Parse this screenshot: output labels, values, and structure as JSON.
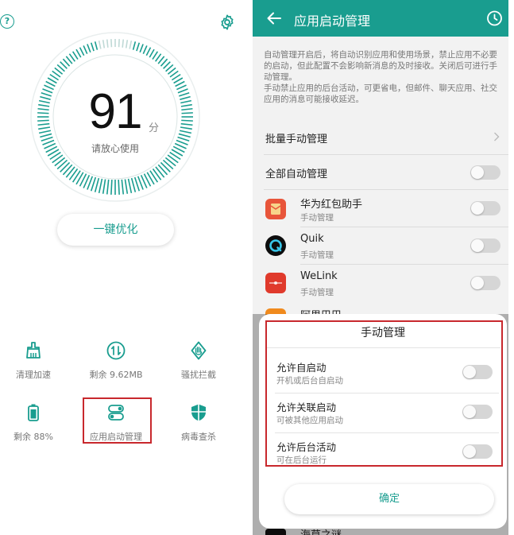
{
  "left": {
    "score": "91",
    "score_unit": "分",
    "score_subtitle": "请放心使用",
    "optimize_label": "一键优化",
    "tools": [
      {
        "label": "清理加速",
        "icon": "cleaner-icon"
      },
      {
        "label": "剩余 9.62MB",
        "icon": "data-usage-icon"
      },
      {
        "label": "骚扰拦截",
        "icon": "block-harassment-icon"
      },
      {
        "label": "剩余 88%",
        "icon": "battery-icon"
      },
      {
        "label": "应用启动管理",
        "icon": "app-launch-icon"
      },
      {
        "label": "病毒查杀",
        "icon": "virus-scan-icon"
      }
    ],
    "colors": {
      "accent": "#199d8f",
      "highlight": "#c8282d"
    }
  },
  "right": {
    "appbar_title": "应用启动管理",
    "description_1": "自动管理开启后，将自动识别应用和使用场景，禁止应用不必要的启动，但此配置不会影响新消息的及时接收。关闭后可进行手动管理。",
    "description_2": "手动禁止应用的后台活动，可更省电，但邮件、聊天应用、社交应用的消息可能接收延迟。",
    "batch_manual": "批量手动管理",
    "all_auto": "全部自动管理",
    "apps": [
      {
        "name": "华为红包助手",
        "mode": "手动管理",
        "color": "#e8553a"
      },
      {
        "name": "Quik",
        "mode": "手动管理",
        "color": "#0d0d0d"
      },
      {
        "name": "WeLink",
        "mode": "手动管理",
        "color": "#e03a2c"
      },
      {
        "name": "阿里巴巴",
        "mode": "",
        "color": "#f08a1d"
      }
    ],
    "dialog": {
      "title": "手动管理",
      "options": [
        {
          "title": "允许自启动",
          "subtitle": "开机或后台自启动"
        },
        {
          "title": "允许关联启动",
          "subtitle": "可被其他应用启动"
        },
        {
          "title": "允许后台活动",
          "subtitle": "可在后台运行"
        }
      ],
      "confirm_label": "确定"
    },
    "peek_app": "海草之谜"
  }
}
